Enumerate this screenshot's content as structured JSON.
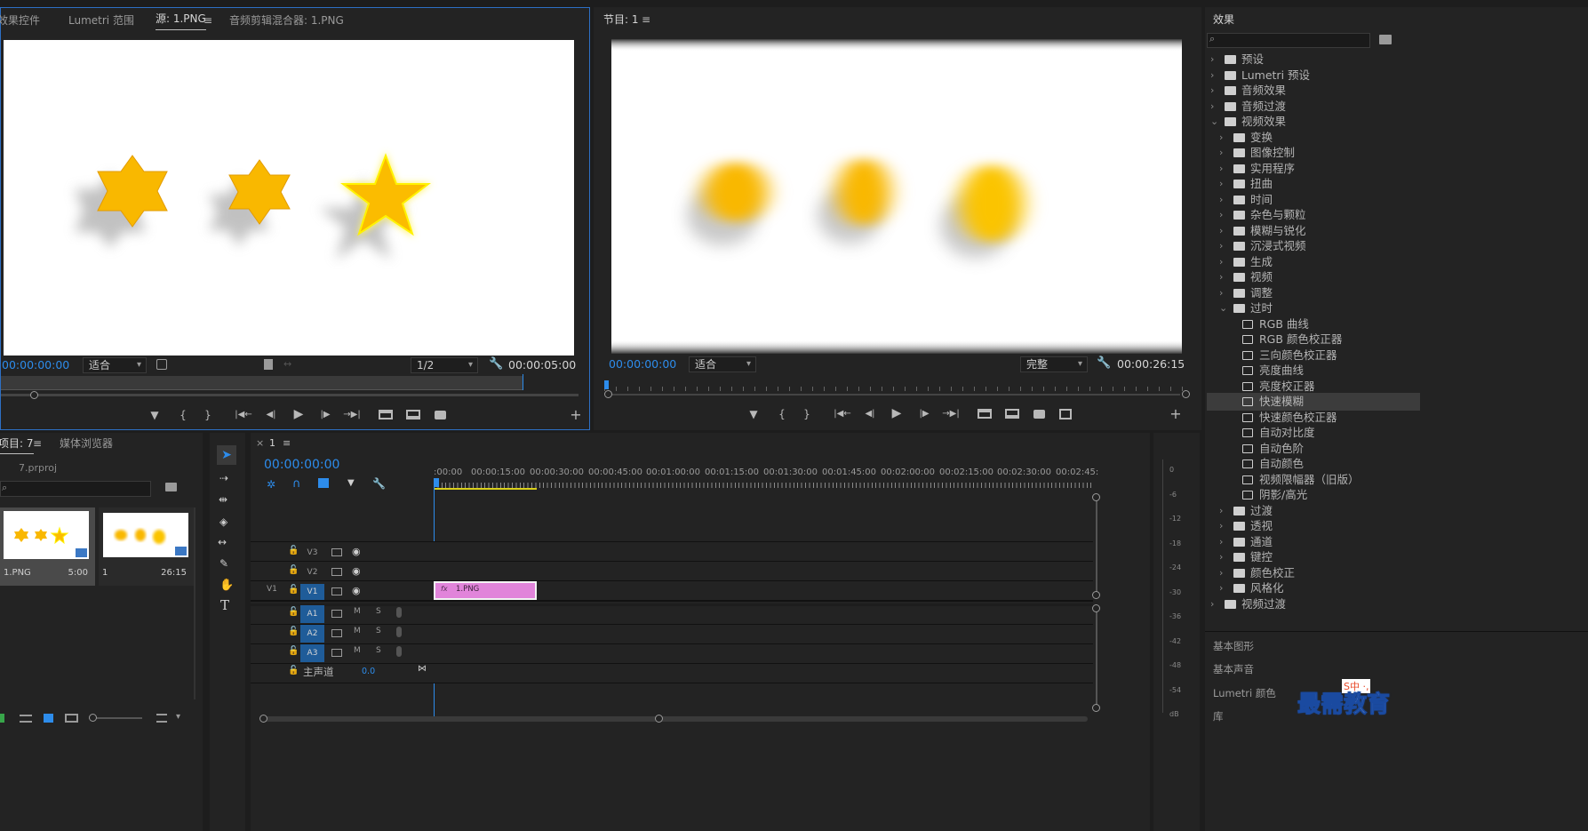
{
  "source_monitor": {
    "tabs": [
      "效果控件",
      "Lumetri 范围",
      "源: 1.PNG",
      "音频剪辑混合器: 1.PNG"
    ],
    "menu_glyph": "≡",
    "timecode_in": "00:00:00:00",
    "fit": "适合",
    "resolution": "1/2",
    "timecode_duration": "00:00:05:00"
  },
  "program_monitor": {
    "tab": "节目: 1",
    "menu_glyph": "≡",
    "timecode_in": "00:00:00:00",
    "fit": "适合",
    "quality": "完整",
    "timecode_duration": "00:00:26:15"
  },
  "transport": {
    "marker": "▼",
    "mark_in": "{",
    "mark_out": "}",
    "go_in": "|◀←",
    "step_back": "◀|",
    "play": "▶",
    "step_fwd": "|▶",
    "go_out": "→▶|",
    "add": "+"
  },
  "project": {
    "tabs": [
      "项目: 7",
      "媒体浏览器"
    ],
    "menu_glyph": "≡",
    "file": "7.prproj",
    "items": [
      {
        "name": "1.PNG",
        "duration": "5:00"
      },
      {
        "name": "1",
        "duration": "26:15"
      }
    ]
  },
  "timeline": {
    "close": "×",
    "sequence": "1",
    "menu_glyph": "≡",
    "timecode": "00:00:00:00",
    "ruler": [
      ":00:00",
      "00:00:15:00",
      "00:00:30:00",
      "00:00:45:00",
      "00:01:00:00",
      "00:01:15:00",
      "00:01:30:00",
      "00:01:45:00",
      "00:02:00:00",
      "00:02:15:00",
      "00:02:30:00",
      "00:02:45:"
    ],
    "video_tracks": [
      {
        "src": "",
        "name": "V3"
      },
      {
        "src": "",
        "name": "V2"
      },
      {
        "src": "V1",
        "name": "V1"
      }
    ],
    "audio_tracks": [
      {
        "name": "A1",
        "m": "M",
        "s": "S"
      },
      {
        "name": "A2",
        "m": "M",
        "s": "S"
      },
      {
        "name": "A3",
        "m": "M",
        "s": "S"
      }
    ],
    "master": {
      "label": "主声道",
      "value": "0.0"
    },
    "clip": {
      "fx": "fx",
      "name": "1.PNG"
    }
  },
  "audio_meter": {
    "ticks": [
      "0",
      "-6",
      "-12",
      "-18",
      "-24",
      "-30",
      "-36",
      "-42",
      "-48",
      "-54",
      "dB"
    ]
  },
  "effects": {
    "title": "效果",
    "search_placeholder": "",
    "rows": [
      {
        "depth": 0,
        "label": "预设",
        "icon": "folder-star"
      },
      {
        "depth": 0,
        "label": "Lumetri 预设",
        "icon": "folder-star"
      },
      {
        "depth": 0,
        "label": "音频效果",
        "icon": "folder"
      },
      {
        "depth": 0,
        "label": "音频过渡",
        "icon": "folder"
      },
      {
        "depth": 0,
        "label": "视频效果",
        "icon": "folder",
        "open": true
      },
      {
        "depth": 1,
        "label": "变换",
        "icon": "folder"
      },
      {
        "depth": 1,
        "label": "图像控制",
        "icon": "folder"
      },
      {
        "depth": 1,
        "label": "实用程序",
        "icon": "folder"
      },
      {
        "depth": 1,
        "label": "扭曲",
        "icon": "folder"
      },
      {
        "depth": 1,
        "label": "时间",
        "icon": "folder"
      },
      {
        "depth": 1,
        "label": "杂色与颗粒",
        "icon": "folder"
      },
      {
        "depth": 1,
        "label": "模糊与锐化",
        "icon": "folder"
      },
      {
        "depth": 1,
        "label": "沉浸式视频",
        "icon": "folder"
      },
      {
        "depth": 1,
        "label": "生成",
        "icon": "folder"
      },
      {
        "depth": 1,
        "label": "视频",
        "icon": "folder"
      },
      {
        "depth": 1,
        "label": "调整",
        "icon": "folder"
      },
      {
        "depth": 1,
        "label": "过时",
        "icon": "folder",
        "open": true
      },
      {
        "depth": 2,
        "label": "RGB 曲线",
        "icon": "fx"
      },
      {
        "depth": 2,
        "label": "RGB 颜色校正器",
        "icon": "fx"
      },
      {
        "depth": 2,
        "label": "三向颜色校正器",
        "icon": "fx"
      },
      {
        "depth": 2,
        "label": "亮度曲线",
        "icon": "fx"
      },
      {
        "depth": 2,
        "label": "亮度校正器",
        "icon": "fx"
      },
      {
        "depth": 2,
        "label": "快速模糊",
        "icon": "fx",
        "selected": true
      },
      {
        "depth": 2,
        "label": "快速颜色校正器",
        "icon": "fx"
      },
      {
        "depth": 2,
        "label": "自动对比度",
        "icon": "fx"
      },
      {
        "depth": 2,
        "label": "自动色阶",
        "icon": "fx"
      },
      {
        "depth": 2,
        "label": "自动颜色",
        "icon": "fx"
      },
      {
        "depth": 2,
        "label": "视频限幅器（旧版）",
        "icon": "fx"
      },
      {
        "depth": 2,
        "label": "阴影/高光",
        "icon": "fx"
      },
      {
        "depth": 1,
        "label": "过渡",
        "icon": "folder"
      },
      {
        "depth": 1,
        "label": "透视",
        "icon": "folder"
      },
      {
        "depth": 1,
        "label": "通道",
        "icon": "folder"
      },
      {
        "depth": 1,
        "label": "键控",
        "icon": "folder"
      },
      {
        "depth": 1,
        "label": "颜色校正",
        "icon": "folder"
      },
      {
        "depth": 1,
        "label": "风格化",
        "icon": "folder"
      },
      {
        "depth": 0,
        "label": "视频过渡",
        "icon": "folder"
      }
    ],
    "bottom_panels": [
      "基本图形",
      "基本声音",
      "Lumetri 颜色",
      "库"
    ]
  },
  "watermark": {
    "text": "最需教育",
    "badge": "S中 ·,"
  }
}
